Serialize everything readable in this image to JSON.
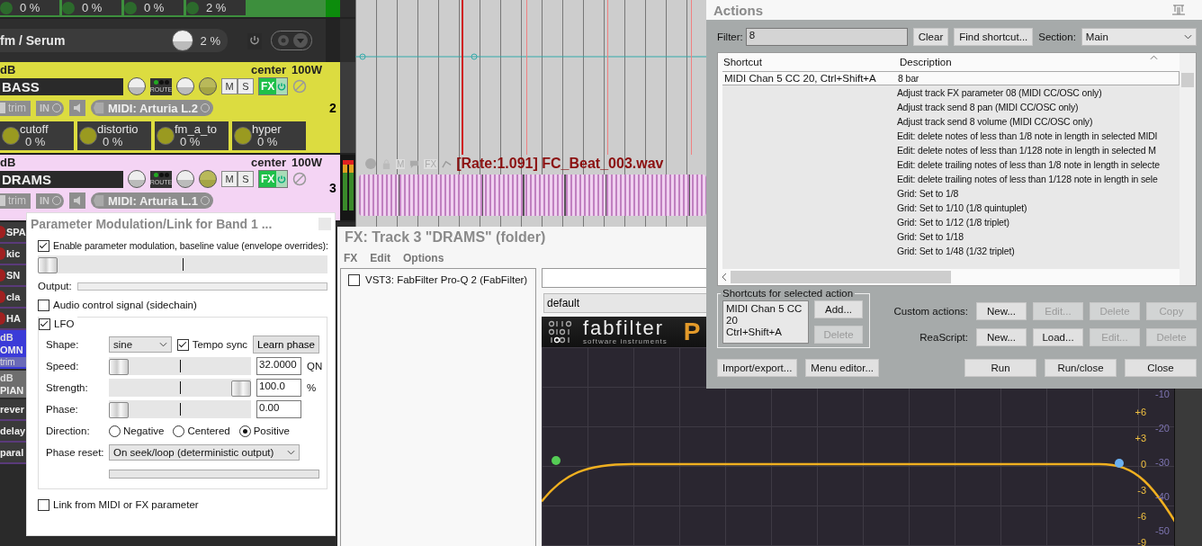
{
  "tracks_panel": {
    "top_params": [
      {
        "value": "0 %"
      },
      {
        "value": "0 %"
      },
      {
        "value": "0 %"
      },
      {
        "value": "2 %"
      }
    ],
    "fx_row": {
      "name": "fm / Serum",
      "value": "2 %"
    },
    "tracks": [
      {
        "name": "BASS",
        "color": "#dcdc40",
        "volume": "dB",
        "pan": "center",
        "width": "100W",
        "route": "ROUTE",
        "mute": "M",
        "solo": "S",
        "fx": "FX",
        "trim": "trim",
        "input": "IN",
        "midi_input": "MIDI: Arturia L.2",
        "number": "2",
        "metering": false,
        "params": [
          {
            "name": "cutoff",
            "value": "0 %"
          },
          {
            "name": "distortio",
            "value": "0 %"
          },
          {
            "name": "fm_a_to",
            "value": "0 %"
          },
          {
            "name": "hyper",
            "value": "0 %"
          }
        ]
      },
      {
        "name": "DRAMS",
        "color": "#f4d4f4",
        "volume": "dB",
        "pan": "center",
        "width": "100W",
        "route": "ROUTE",
        "mute": "M",
        "solo": "S",
        "fx": "FX",
        "trim": "trim",
        "input": "IN",
        "midi_input": "MIDI: Arturia L.1",
        "number": "3",
        "metering": true
      }
    ],
    "partial": [
      {
        "kind": "child",
        "name": "SPA"
      },
      {
        "kind": "child",
        "name": "kic"
      },
      {
        "kind": "child",
        "name": "SN"
      },
      {
        "kind": "child",
        "name": "cla"
      },
      {
        "kind": "child",
        "name": "HA"
      },
      {
        "kind": "track",
        "volume": "dB",
        "name": "OMN",
        "trim": "trim",
        "color": "#3b3bd8"
      },
      {
        "kind": "track",
        "volume": "dB",
        "name": "PIAN",
        "color": "#6e6e6e"
      },
      {
        "kind": "send",
        "name": "rever"
      },
      {
        "kind": "send",
        "name": "delay"
      },
      {
        "kind": "send",
        "name": "paral"
      }
    ]
  },
  "arrange": {
    "item": {
      "buttons": [
        "M",
        "FX"
      ],
      "title": "[Rate:1.091] FC_Beat_003.wav"
    }
  },
  "modulation": {
    "title": "Parameter Modulation/Link for Band 1 ...",
    "enable": {
      "label": "Enable parameter modulation, baseline value (envelope overrides):",
      "checked": true,
      "level": 0
    },
    "output_label": "Output:",
    "audio_control": {
      "label": "Audio control signal (sidechain)",
      "checked": false
    },
    "lfo": {
      "label": "LFO",
      "checked": true,
      "shape_label": "Shape:",
      "shape": "sine",
      "tempo_sync": {
        "label": "Tempo sync",
        "checked": true
      },
      "learn_phase": "Learn phase",
      "sliders": [
        {
          "label": "Speed:",
          "level": 0,
          "value": "32.0000",
          "unit": "QN"
        },
        {
          "label": "Strength:",
          "level": 1,
          "value": "100.0",
          "unit": "%"
        },
        {
          "label": "Phase:",
          "level": 0,
          "value": "0.00"
        }
      ],
      "direction_label": "Direction:",
      "directions": [
        {
          "label": "Negative",
          "selected": false
        },
        {
          "label": "Centered",
          "selected": false
        },
        {
          "label": "Positive",
          "selected": true
        }
      ],
      "phase_reset_label": "Phase reset:",
      "phase_reset": "On seek/loop (deterministic output)"
    },
    "link": {
      "label": "Link from MIDI or FX parameter",
      "checked": false
    }
  },
  "fx_window": {
    "title": "FX: Track 3 \"DRAMS\" (folder)",
    "menu": [
      "FX",
      "Edit",
      "Options"
    ],
    "chain": [
      {
        "name": "VST3: FabFilter Pro-Q 2 (FabFilter)",
        "checked": false
      }
    ],
    "preset": "default",
    "plugin": {
      "brand": "fabfilter",
      "tagline": "software instruments",
      "product": "P",
      "gain_scale": [
        "+6",
        "+3",
        "0",
        "-3",
        "-6",
        "-9"
      ],
      "level_scale": [
        "-10",
        "-20",
        "-30",
        "-40",
        "-50"
      ]
    }
  },
  "actions": {
    "title": "Actions",
    "filter_label": "Filter:",
    "filter_value": "8",
    "clear": "Clear",
    "find": "Find shortcut...",
    "section_label": "Section:",
    "section": "Main",
    "columns": [
      "Shortcut",
      "Description"
    ],
    "rows": [
      {
        "shortcut": "MIDI Chan 5 CC 20, Ctrl+Shift+A",
        "description": "8 bar",
        "selected": true
      },
      {
        "description": "Adjust track FX parameter 08 (MIDI CC/OSC only)",
        "selected": false
      },
      {
        "description": "Adjust track send 8 pan (MIDI CC/OSC only)",
        "selected": false
      },
      {
        "description": "Adjust track send 8 volume (MIDI CC/OSC only)",
        "selected": false
      },
      {
        "description": "Edit: delete notes of less than 1/8 note in length in selected MIDI",
        "selected": false
      },
      {
        "description": "Edit: delete notes of less than 1/128 note in length in selected M",
        "selected": false
      },
      {
        "description": "Edit: delete trailing notes of less than 1/8 note in length in selecte",
        "selected": false
      },
      {
        "description": "Edit: delete trailing notes of less than 1/128 note in length in sele",
        "selected": false
      },
      {
        "description": "Grid: Set to 1/8",
        "selected": false
      },
      {
        "description": "Grid: Set to 1/10 (1/8 quintuplet)",
        "selected": false
      },
      {
        "description": "Grid: Set to 1/12 (1/8 triplet)",
        "selected": false
      },
      {
        "description": "Grid: Set to 1/18",
        "selected": false
      },
      {
        "description": "Grid: Set to 1/48 (1/32 triplet)",
        "selected": false
      }
    ],
    "shortcuts_group": {
      "title": "Shortcuts for selected action",
      "lines": [
        "MIDI Chan 5 CC 20",
        "Ctrl+Shift+A"
      ],
      "buttons": [
        {
          "label": "Add...",
          "disabled": false
        },
        {
          "label": "Delete",
          "disabled": true
        }
      ]
    },
    "button_rows": [
      {
        "label": "Custom actions:",
        "buttons": [
          {
            "label": "New...",
            "disabled": false
          },
          {
            "label": "Edit...",
            "disabled": true
          },
          {
            "label": "Delete",
            "disabled": true
          },
          {
            "label": "Copy",
            "disabled": true
          }
        ]
      },
      {
        "label": "ReaScript:",
        "buttons": [
          {
            "label": "New...",
            "disabled": false
          },
          {
            "label": "Load...",
            "disabled": false
          },
          {
            "label": "Edit...",
            "disabled": true
          },
          {
            "label": "Delete",
            "disabled": true
          }
        ]
      }
    ],
    "left_buttons": [
      "Import/export...",
      "Menu editor..."
    ],
    "right_buttons": [
      "Run",
      "Run/close",
      "Close"
    ]
  }
}
